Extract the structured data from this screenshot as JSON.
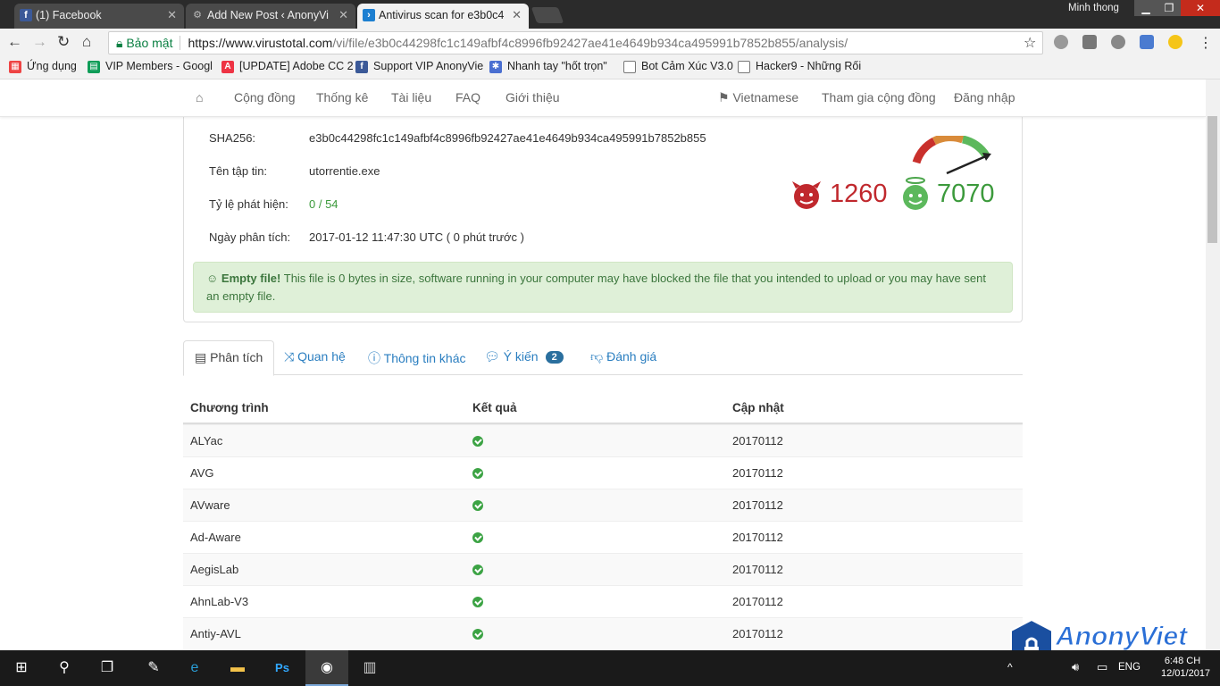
{
  "browser": {
    "tabs": [
      {
        "title": "(1) Facebook",
        "icon": "facebook-icon"
      },
      {
        "title": "Add New Post ‹ AnonyVi",
        "icon": "gear-icon"
      },
      {
        "title": "Antivirus scan for e3b0c4",
        "icon": "virustotal-icon"
      }
    ],
    "user_name": "Minh thong",
    "url": {
      "secure_label": "Bảo mật",
      "host": "https://www.virustotal.com",
      "path": "/vi/file/e3b0c44298fc1c149afbf4c8996fb92427ae41e4649b934ca495991b7852b855/analysis/"
    },
    "bookmarks": [
      {
        "label": "Ứng dụng",
        "icon": "apps-icon",
        "color": "#e44"
      },
      {
        "label": "VIP Members - Googl",
        "icon": "sheets-icon",
        "color": "#0f9d58"
      },
      {
        "label": "[UPDATE] Adobe CC 2",
        "icon": "adobe-icon",
        "color": "#e34"
      },
      {
        "label": "Support VIP AnonyVie",
        "icon": "facebook-icon",
        "color": "#3b5998"
      },
      {
        "label": "Nhanh tay \"hốt trọn\"",
        "icon": "gear-icon",
        "color": "#4a6fd1"
      },
      {
        "label": "Bot Cảm Xúc V3.0",
        "icon": "page-icon",
        "color": "#fff"
      },
      {
        "label": "Hacker9 - Những Rối",
        "icon": "page-icon",
        "color": "#fff"
      }
    ]
  },
  "site_nav": {
    "home_icon": "home-icon",
    "items": [
      "Cộng đồng",
      "Thống kê",
      "Tài liệu",
      "FAQ",
      "Giới thiệu"
    ],
    "language": "Vietnamese",
    "join": "Tham gia cộng đồng",
    "login": "Đăng nhập"
  },
  "file_info": {
    "sha256_label": "SHA256:",
    "sha256": "e3b0c44298fc1c149afbf4c8996fb92427ae41e4649b934ca495991b7852b855",
    "filename_label": "Tên tập tin:",
    "filename": "utorrentie.exe",
    "ratio_label": "Tỷ lệ phát hiện:",
    "ratio": "0 / 54",
    "date_label": "Ngày phân tích:",
    "date": "2017-01-12 11:47:30 UTC ( 0 phút trước )"
  },
  "votes": {
    "bad": "1260",
    "good": "7070"
  },
  "alert": {
    "title": "Empty file!",
    "text": " This file is 0 bytes in size, software running in your computer may have blocked the file that you intended to upload or you may have sent an empty file."
  },
  "tabs": [
    {
      "label": "Phân tích",
      "icon": "table-icon"
    },
    {
      "label": "Quan hệ",
      "icon": "shuffle-icon"
    },
    {
      "label": "Thông tin khác",
      "icon": "info-icon"
    },
    {
      "label": "Ý kiến",
      "icon": "comment-icon",
      "badge": "2"
    },
    {
      "label": "Đánh giá",
      "icon": "thumbs-down-icon"
    }
  ],
  "results": {
    "headers": [
      "Chương trình",
      "Kết quả",
      "Cập nhật"
    ],
    "rows": [
      {
        "engine": "ALYac",
        "date": "20170112"
      },
      {
        "engine": "AVG",
        "date": "20170112"
      },
      {
        "engine": "AVware",
        "date": "20170112"
      },
      {
        "engine": "Ad-Aware",
        "date": "20170112"
      },
      {
        "engine": "AegisLab",
        "date": "20170112"
      },
      {
        "engine": "AhnLab-V3",
        "date": "20170112"
      },
      {
        "engine": "Antiy-AVL",
        "date": "20170112"
      }
    ]
  },
  "watermark": "AnonyViet",
  "taskbar": {
    "lang": "ENG",
    "time": "6:48 CH",
    "date": "12/01/2017"
  }
}
